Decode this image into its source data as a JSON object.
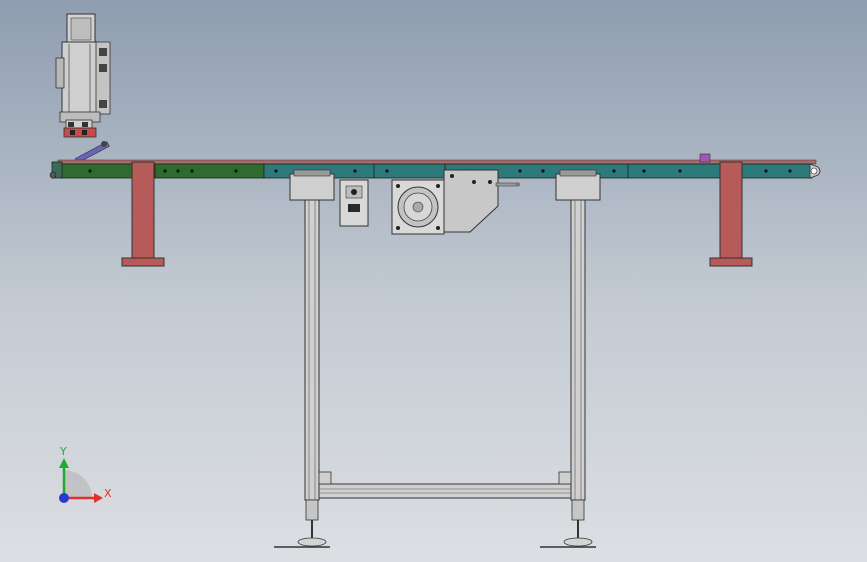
{
  "viewport": {
    "background_top": "#8f9db0",
    "background_bottom": "#dcdfe3"
  },
  "model": {
    "belt_green": "#2f6b2f",
    "belt_teal": "#2c7a7a",
    "support_red": "#b65a5a",
    "frame_gray": "#c9c9c9",
    "accent_purple": "#9b59b6"
  },
  "triad": {
    "x_label": "X",
    "y_label": "Y",
    "x_color": "#e0302a",
    "y_color": "#22aa33",
    "z_color": "#2a3ad0"
  }
}
